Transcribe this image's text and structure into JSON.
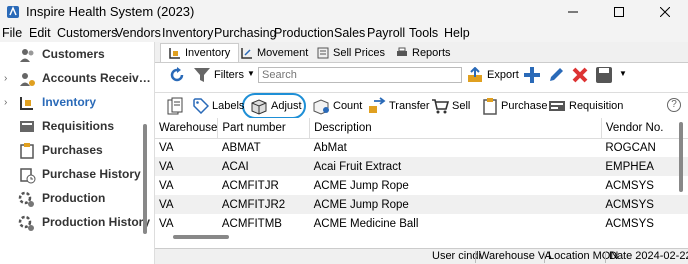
{
  "window": {
    "title": "Inspire Health System (2023)"
  },
  "menu": [
    "File",
    "Edit",
    "Customers",
    "Vendors",
    "Inventory",
    "Purchasing",
    "Production",
    "Sales",
    "Payroll",
    "Tools",
    "Help"
  ],
  "sidebar": {
    "items": [
      {
        "label": "Customers",
        "icon": "customers-icon",
        "chevron": false
      },
      {
        "label": "Accounts Receiv…",
        "icon": "accounts-receivable-icon",
        "chevron": true
      },
      {
        "label": "Inventory",
        "icon": "inventory-icon",
        "chevron": true,
        "active": true
      },
      {
        "label": "Requisitions",
        "icon": "requisitions-icon",
        "chevron": false
      },
      {
        "label": "Purchases",
        "icon": "purchases-icon",
        "chevron": false
      },
      {
        "label": "Purchase History",
        "icon": "purchase-history-icon",
        "chevron": false
      },
      {
        "label": "Production",
        "icon": "production-icon",
        "chevron": false
      },
      {
        "label": "Production History",
        "icon": "production-history-icon",
        "chevron": false
      }
    ]
  },
  "tabs": [
    "Inventory",
    "Movement",
    "Sell Prices",
    "Reports"
  ],
  "toolbar1": {
    "filters": "Filters",
    "search_placeholder": "Search",
    "export": "Export"
  },
  "toolbar2": {
    "labels": "Labels",
    "adjust": "Adjust",
    "count": "Count",
    "transfer": "Transfer",
    "sell": "Sell",
    "purchase": "Purchase",
    "requisition": "Requisition",
    "help": "?"
  },
  "grid": {
    "columns": [
      "Warehouse",
      "Part number",
      "Description",
      "Vendor No."
    ],
    "rows": [
      [
        "VA",
        "ABMAT",
        "AbMat",
        "ROGCAN"
      ],
      [
        "VA",
        "ACAI",
        "Acai Fruit Extract",
        "EMPHEA"
      ],
      [
        "VA",
        "ACMFITJR",
        "ACME Jump Rope",
        "ACMSYS"
      ],
      [
        "VA",
        "ACMFITJR2",
        "ACME Jump Rope",
        "ACMSYS"
      ],
      [
        "VA",
        "ACMFITMB",
        "ACME Medicine Ball",
        "ACMSYS"
      ]
    ]
  },
  "status": {
    "user": "User cindi",
    "warehouse": "Warehouse VA",
    "location": "Location MON",
    "date": "Date 2024-02-22"
  },
  "colors": {
    "accent": "#2a6ab8",
    "highlight": "#1e8fd6"
  }
}
